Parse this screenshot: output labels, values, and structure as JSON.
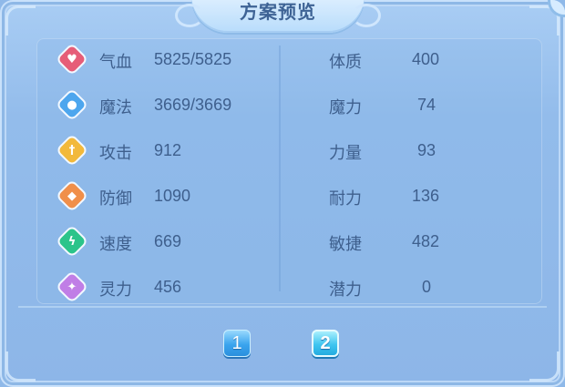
{
  "title": "方案预览",
  "left_stats": [
    {
      "label": "气血",
      "value": "5825/5825",
      "icon": "heart-icon",
      "color": "#e65d78",
      "glyph": "♥"
    },
    {
      "label": "魔法",
      "value": "3669/3669",
      "icon": "mana-icon",
      "color": "#4da6ee",
      "glyph": "●"
    },
    {
      "label": "攻击",
      "value": "912",
      "icon": "sword-icon",
      "color": "#f2b93b",
      "glyph": "†"
    },
    {
      "label": "防御",
      "value": "1090",
      "icon": "shield-icon",
      "color": "#f08f4a",
      "glyph": "◆"
    },
    {
      "label": "速度",
      "value": "669",
      "icon": "lightning-icon",
      "color": "#2bc48a",
      "glyph": "ϟ"
    },
    {
      "label": "灵力",
      "value": "456",
      "icon": "spirit-icon",
      "color": "#c07ee6",
      "glyph": "✦"
    }
  ],
  "right_stats": [
    {
      "label": "体质",
      "value": "400"
    },
    {
      "label": "魔力",
      "value": "74"
    },
    {
      "label": "力量",
      "value": "93"
    },
    {
      "label": "耐力",
      "value": "136"
    },
    {
      "label": "敏捷",
      "value": "482"
    },
    {
      "label": "潜力",
      "value": "0"
    }
  ],
  "pages": [
    {
      "label": "1",
      "active": false
    },
    {
      "label": "2",
      "active": true
    }
  ]
}
